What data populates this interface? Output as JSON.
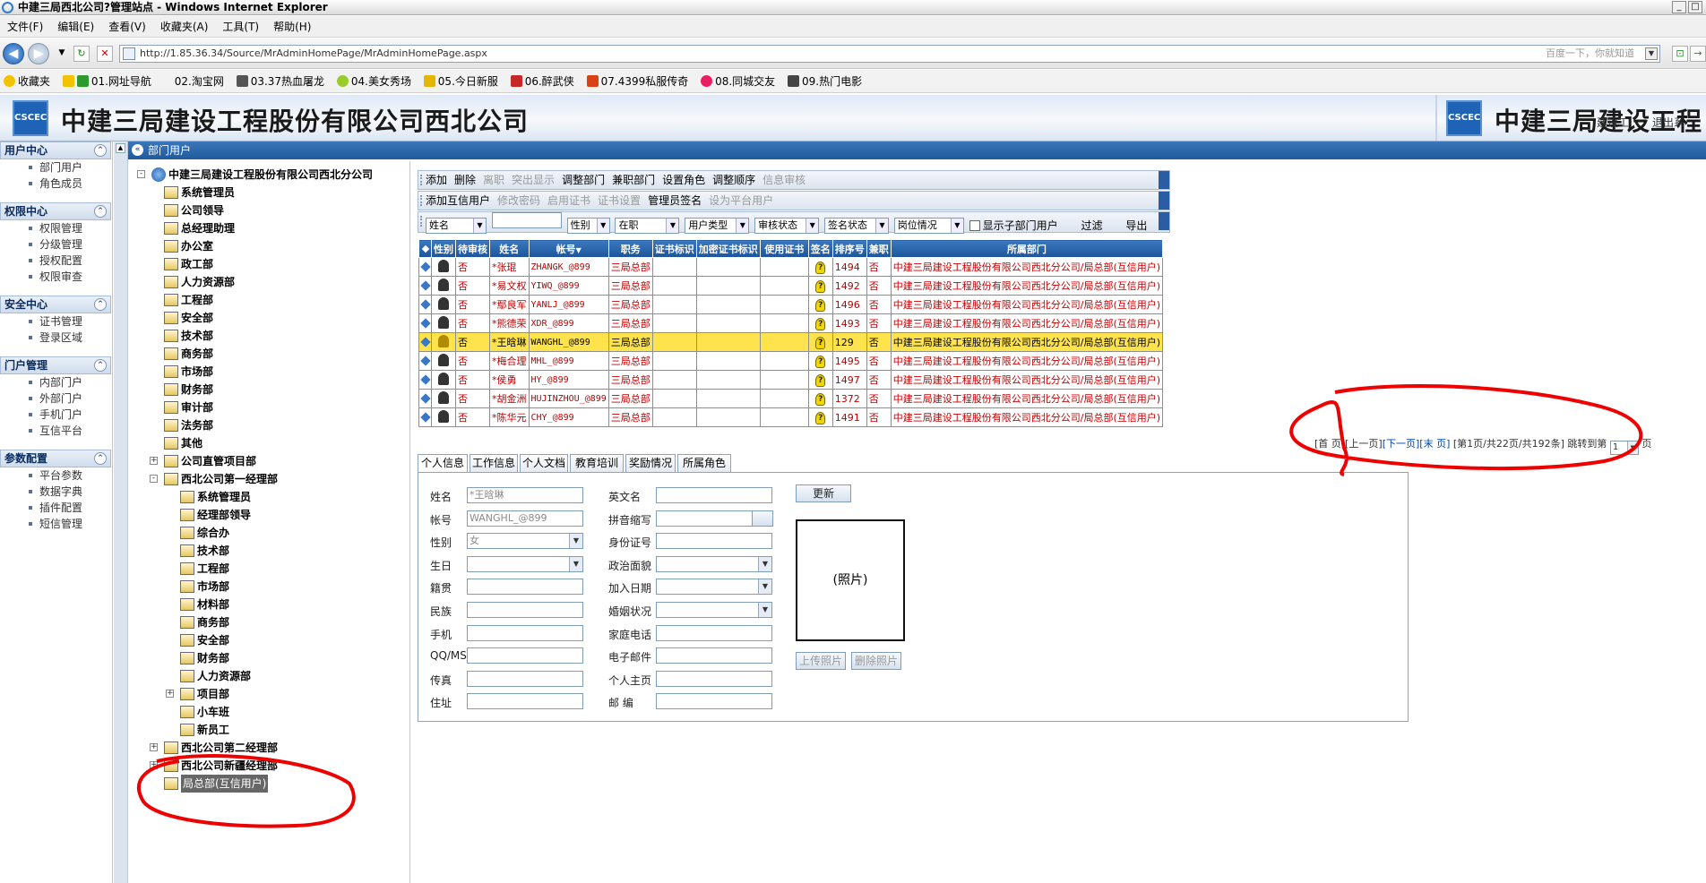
{
  "browser": {
    "title": "中建三局西北公司?管理站点 - Windows Internet Explorer",
    "menu": [
      "文件(F)",
      "编辑(E)",
      "查看(V)",
      "收藏夹(A)",
      "工具(T)",
      "帮助(H)"
    ],
    "url": "http://1.85.36.34/Source/MrAdminHomePage/MrAdminHomePage.aspx",
    "search_hint": "百度一下，你就知道",
    "favorites_label": "收藏夹",
    "favorites": [
      "01.网址导航",
      "02.淘宝网",
      "03.37热血屠龙",
      "04.美女秀场",
      "05.今日新服",
      "06.醉武侠",
      "07.4399私服传奇",
      "08.同城交友",
      "09.热门电影"
    ]
  },
  "header": {
    "logo_text": "CSCEC",
    "company": "中建三局建设工程股份有限公司西北公司",
    "company_repeat": "中建三局建设工程股",
    "overlay": "建设工",
    "exit": "退出系"
  },
  "leftnav": [
    {
      "title": "用户中心",
      "items": [
        "部门用户",
        "角色成员"
      ]
    },
    {
      "title": "权限中心",
      "items": [
        "权限管理",
        "分级管理",
        "授权配置",
        "权限审查"
      ]
    },
    {
      "title": "安全中心",
      "items": [
        "证书管理",
        "登录区域"
      ]
    },
    {
      "title": "门户管理",
      "items": [
        "内部门户",
        "外部门户",
        "手机门户",
        "互信平台"
      ]
    },
    {
      "title": "参数配置",
      "items": [
        "平台参数",
        "数据字典",
        "插件配置",
        "短信管理"
      ]
    }
  ],
  "breadcrumb": "部门用户",
  "tree": {
    "root": "中建三局建设工程股份有限公司西北分公司",
    "level1": [
      "系统管理员",
      "公司领导",
      "总经理助理",
      "办公室",
      "政工部",
      "人力资源部",
      "工程部",
      "安全部",
      "技术部",
      "商务部",
      "市场部",
      "财务部",
      "审计部",
      "法务部",
      "其他",
      "公司直管项目部",
      "西北公司第一经理部"
    ],
    "level2": [
      "系统管理员",
      "经理部领导",
      "综合办",
      "技术部",
      "工程部",
      "市场部",
      "材料部",
      "商务部",
      "安全部",
      "财务部",
      "人力资源部",
      "项目部",
      "小车班",
      "新员工"
    ],
    "after": [
      "西北公司第二经理部",
      "西北公司新疆经理部",
      "局总部(互信用户)"
    ]
  },
  "toolbar1": {
    "items": [
      "添加",
      "删除",
      "离职",
      "突出显示",
      "调整部门",
      "兼职部门",
      "设置角色",
      "调整顺序",
      "信息审核"
    ],
    "disabled": [
      2,
      3,
      8
    ]
  },
  "toolbar2": {
    "items": [
      "添加互信用户",
      "修改密码",
      "启用证书",
      "证书设置",
      "管理员签名",
      "设为平台用户"
    ],
    "disabled": [
      1,
      2,
      3,
      5
    ]
  },
  "filters": {
    "name_field": "姓名",
    "gender": "性别",
    "status": "在职",
    "user_type": "用户类型",
    "review": "审核状态",
    "sign": "签名状态",
    "post": "岗位情况",
    "show_sub": "显示子部门用户",
    "filter_btn": "过滤",
    "export_btn": "导出"
  },
  "grid": {
    "columns": [
      "性别",
      "待审核",
      "姓名",
      "帐号",
      "职务",
      "证书标识",
      "加密证书标识",
      "使用证书",
      "签名",
      "排序号",
      "兼职",
      "所属部门"
    ],
    "sort_indicator": "▼",
    "rows": [
      {
        "pending": "否",
        "name": "*张琨",
        "account": "ZHANGK_@899",
        "title": "三局总部",
        "sign": "?",
        "order": "1494",
        "parttime": "否",
        "dept": "中建三局建设工程股份有限公司西北分公司/局总部(互信用户)"
      },
      {
        "pending": "否",
        "name": "*易文权",
        "account": "YIWQ_@899",
        "title": "三局总部",
        "sign": "?",
        "order": "1492",
        "parttime": "否",
        "dept": "中建三局建设工程股份有限公司西北分公司/局总部(互信用户)"
      },
      {
        "pending": "否",
        "name": "*鄢良军",
        "account": "YANLJ_@899",
        "title": "三局总部",
        "sign": "?",
        "order": "1496",
        "parttime": "否",
        "dept": "中建三局建设工程股份有限公司西北分公司/局总部(互信用户)"
      },
      {
        "pending": "否",
        "name": "*熊德荣",
        "account": "XDR_@899",
        "title": "三局总部",
        "sign": "?",
        "order": "1493",
        "parttime": "否",
        "dept": "中建三局建设工程股份有限公司西北分公司/局总部(互信用户)"
      },
      {
        "pending": "否",
        "name": "*王晗琳",
        "account": "WANGHL_@899",
        "title": "三局总部",
        "sign": "?",
        "order": "129",
        "parttime": "否",
        "dept": "中建三局建设工程股份有限公司西北分公司/局总部(互信用户)",
        "highlight": true
      },
      {
        "pending": "否",
        "name": "*梅合理",
        "account": "MHL_@899",
        "title": "三局总部",
        "sign": "?",
        "order": "1495",
        "parttime": "否",
        "dept": "中建三局建设工程股份有限公司西北分公司/局总部(互信用户)"
      },
      {
        "pending": "否",
        "name": "*侯勇",
        "account": "HY_@899",
        "title": "三局总部",
        "sign": "?",
        "order": "1497",
        "parttime": "否",
        "dept": "中建三局建设工程股份有限公司西北分公司/局总部(互信用户)"
      },
      {
        "pending": "否",
        "name": "*胡金洲",
        "account": "HUJINZHOU_@899",
        "title": "三局总部",
        "sign": "?",
        "order": "1372",
        "parttime": "否",
        "dept": "中建三局建设工程股份有限公司西北分公司/局总部(互信用户)"
      },
      {
        "pending": "否",
        "name": "*陈华元",
        "account": "CHY_@899",
        "title": "三局总部",
        "sign": "?",
        "order": "1491",
        "parttime": "否",
        "dept": "中建三局建设工程股份有限公司西北分公司/局总部(互信用户)"
      }
    ]
  },
  "pager": {
    "first": "[首 页]",
    "prev": "[上一页]",
    "next": "[下一页]",
    "last": "[末 页]",
    "info": "[第1页/共22页/共192条]",
    "goto": "跳转到第",
    "page": "1",
    "suffix": "页"
  },
  "tabs": [
    "个人信息",
    "工作信息",
    "个人文档",
    "教育培训",
    "奖励情况",
    "所属角色"
  ],
  "form": {
    "labels_left": [
      "姓名",
      "帐号",
      "性别",
      "生日",
      "籍贯",
      "民族",
      "手机",
      "QQ/MSN",
      "传真",
      "住址"
    ],
    "labels_right": [
      "英文名",
      "拼音缩写",
      "身份证号",
      "政治面貌",
      "加入日期",
      "婚姻状况",
      "家庭电话",
      "电子邮件",
      "个人主页",
      "邮 编"
    ],
    "name_value": "*王晗琳",
    "account_value": "WANGHL_@899",
    "gender_value": "女",
    "update_btn": "更新",
    "photo_label": "(照片)",
    "upload_btn": "上传照片",
    "delete_btn": "删除照片"
  }
}
